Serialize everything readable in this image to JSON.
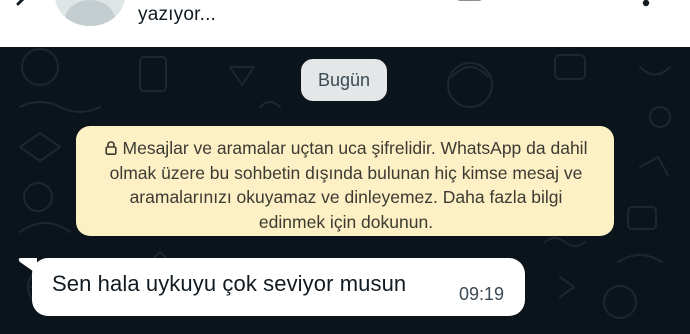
{
  "header": {
    "status": "yazıyor...",
    "icons": [
      "back-arrow-icon",
      "avatar",
      "video-call-icon",
      "voice-call-icon",
      "more-menu-icon"
    ]
  },
  "chat": {
    "date_chip": "Bugün",
    "encryption_notice": "Mesajlar ve aramalar uçtan uca şifrelidir. WhatsApp da dahil olmak üzere bu sohbetin dışında bulunan hiç kimse mesaj ve aramalarınızı okuyamaz ve dinleyemez. Daha fazla bilgi edinmek için dokunun.",
    "messages": [
      {
        "text": "Sen hala uykuyu çok seviyor musun",
        "time": "09:19",
        "direction": "incoming"
      }
    ]
  },
  "colors": {
    "chat_background": "#0b141a",
    "encryption_background": "#fdf0c4",
    "bubble_background": "#ffffff",
    "date_chip_background": "#e4e7e8"
  }
}
